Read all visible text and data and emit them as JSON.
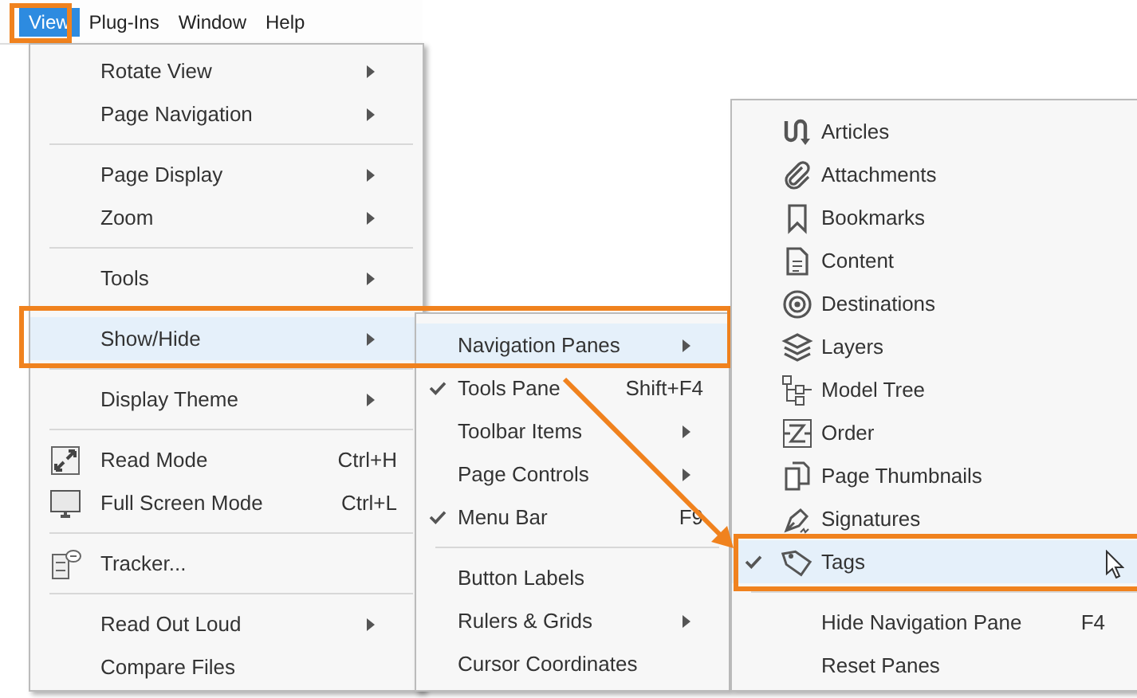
{
  "menu_bar": [
    {
      "label": "View",
      "selected": true
    },
    {
      "label": "Plug-Ins",
      "selected": false
    },
    {
      "label": "Window",
      "selected": false
    },
    {
      "label": "Help",
      "selected": false
    }
  ],
  "view_menu": [
    {
      "kind": "item",
      "label": "Rotate View",
      "submenu": true,
      "highlighted": false
    },
    {
      "kind": "item",
      "label": "Page Navigation",
      "submenu": true,
      "highlighted": false
    },
    {
      "kind": "separator"
    },
    {
      "kind": "item",
      "label": "Page Display",
      "submenu": true,
      "highlighted": false
    },
    {
      "kind": "item",
      "label": "Zoom",
      "submenu": true,
      "highlighted": false
    },
    {
      "kind": "separator"
    },
    {
      "kind": "item",
      "label": "Tools",
      "submenu": true,
      "highlighted": false
    },
    {
      "kind": "separator"
    },
    {
      "kind": "item",
      "label": "Show/Hide",
      "submenu": true,
      "highlighted": true
    },
    {
      "kind": "separator"
    },
    {
      "kind": "item",
      "label": "Display Theme",
      "submenu": true,
      "highlighted": false
    },
    {
      "kind": "separator"
    },
    {
      "kind": "item",
      "label": "Read Mode",
      "shortcut": "Ctrl+H",
      "submenu": false,
      "highlighted": false
    },
    {
      "kind": "item",
      "label": "Full Screen Mode",
      "shortcut": "Ctrl+L",
      "submenu": false,
      "highlighted": false
    },
    {
      "kind": "separator"
    },
    {
      "kind": "item",
      "label": "Tracker...",
      "submenu": false,
      "highlighted": false
    },
    {
      "kind": "separator"
    },
    {
      "kind": "item",
      "label": "Read Out Loud",
      "submenu": true,
      "highlighted": false
    },
    {
      "kind": "item",
      "label": "Compare Files",
      "submenu": false,
      "highlighted": false
    }
  ],
  "show_hide_menu": [
    {
      "kind": "item",
      "label": "Navigation Panes",
      "submenu": true,
      "checked": false,
      "highlighted": true
    },
    {
      "kind": "item",
      "label": "Tools Pane",
      "shortcut": "Shift+F4",
      "submenu": false,
      "checked": true,
      "highlighted": false
    },
    {
      "kind": "item",
      "label": "Toolbar Items",
      "submenu": true,
      "checked": false,
      "highlighted": false
    },
    {
      "kind": "item",
      "label": "Page Controls",
      "submenu": true,
      "checked": false,
      "highlighted": false
    },
    {
      "kind": "item",
      "label": "Menu Bar",
      "shortcut": "F9",
      "submenu": false,
      "checked": true,
      "highlighted": false
    },
    {
      "kind": "separator"
    },
    {
      "kind": "item",
      "label": "Button Labels",
      "submenu": false,
      "checked": false,
      "highlighted": false
    },
    {
      "kind": "item",
      "label": "Rulers & Grids",
      "submenu": true,
      "checked": false,
      "highlighted": false
    },
    {
      "kind": "item",
      "label": "Cursor Coordinates",
      "submenu": false,
      "checked": false,
      "highlighted": false
    }
  ],
  "navigation_panes_menu": [
    {
      "kind": "item",
      "label": "Articles",
      "checked": false,
      "highlighted": false
    },
    {
      "kind": "item",
      "label": "Attachments",
      "checked": false,
      "highlighted": false
    },
    {
      "kind": "item",
      "label": "Bookmarks",
      "checked": false,
      "highlighted": false
    },
    {
      "kind": "item",
      "label": "Content",
      "checked": false,
      "highlighted": false
    },
    {
      "kind": "item",
      "label": "Destinations",
      "checked": false,
      "highlighted": false
    },
    {
      "kind": "item",
      "label": "Layers",
      "checked": false,
      "highlighted": false
    },
    {
      "kind": "item",
      "label": "Model Tree",
      "checked": false,
      "highlighted": false
    },
    {
      "kind": "item",
      "label": "Order",
      "checked": false,
      "highlighted": false
    },
    {
      "kind": "item",
      "label": "Page Thumbnails",
      "checked": false,
      "highlighted": false
    },
    {
      "kind": "item",
      "label": "Signatures",
      "checked": false,
      "highlighted": false
    },
    {
      "kind": "item",
      "label": "Tags",
      "checked": true,
      "highlighted": true
    },
    {
      "kind": "separator"
    },
    {
      "kind": "item",
      "label": "Hide Navigation Pane",
      "shortcut": "F4",
      "checked": false,
      "highlighted": false
    },
    {
      "kind": "item",
      "label": "Reset Panes",
      "checked": false,
      "highlighted": false
    }
  ]
}
